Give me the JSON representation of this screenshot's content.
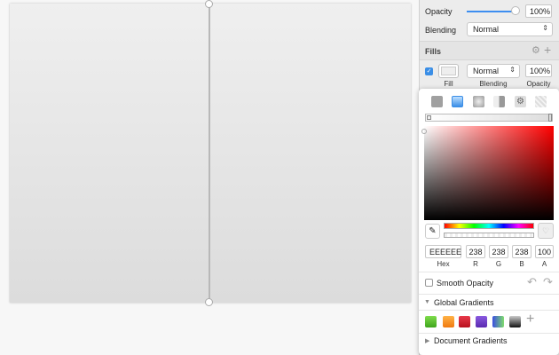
{
  "inspector": {
    "opacity_label": "Opacity",
    "opacity_value": "100%",
    "opacity_level": 1.0,
    "blending_label": "Blending",
    "blending_value": "Normal",
    "fills_title": "Fills",
    "fill": {
      "enabled": true,
      "blending": "Normal",
      "opacity": "100%",
      "fill_caption": "Fill",
      "blending_caption": "Blending",
      "opacity_caption": "Opacity"
    }
  },
  "color_picker": {
    "fill_types": [
      "solid-fill-icon",
      "linear-gradient-icon",
      "radial-gradient-icon",
      "angular-gradient-icon",
      "pattern-fill-icon",
      "noise-fill-icon"
    ],
    "selected_fill_type": "linear-gradient-icon",
    "hex": "EEEEEE",
    "r": "238",
    "g": "238",
    "b": "238",
    "a": "100",
    "hex_label": "Hex",
    "r_label": "R",
    "g_label": "G",
    "b_label": "B",
    "a_label": "A",
    "smooth_opacity_label": "Smooth Opacity",
    "smooth_opacity": false,
    "global_gradients_label": "Global Gradients",
    "global_gradients": [
      "#5cc133",
      "#f7931e",
      "#d42030",
      "#6a3fc8",
      "#3f6fe0",
      "#222222"
    ],
    "document_gradients_label": "Document Gradients"
  }
}
